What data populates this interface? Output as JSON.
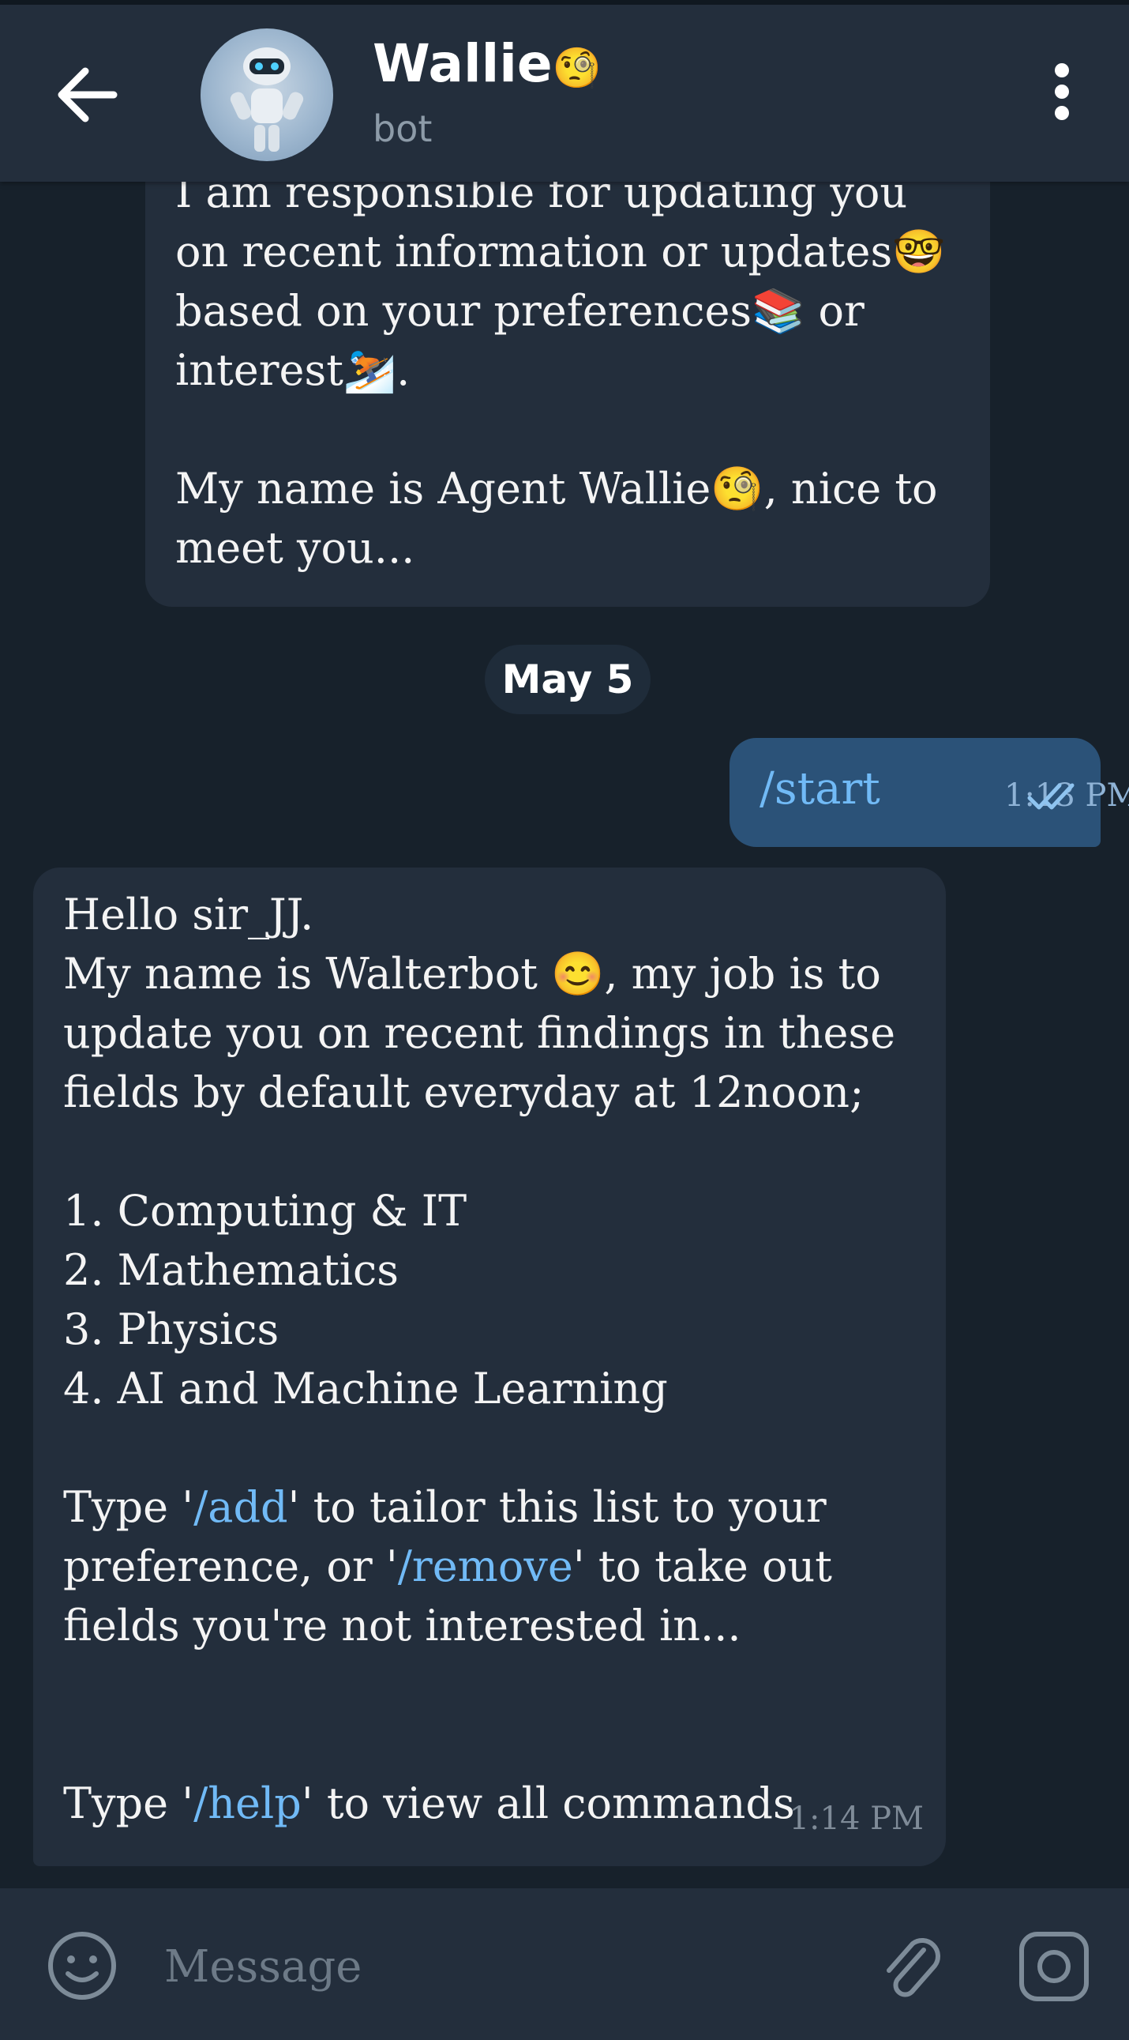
{
  "header": {
    "title": "Wallie",
    "title_emoji": "🧐",
    "subtitle": "bot"
  },
  "date_divider": "May 5",
  "messages": {
    "bot_intro_partial": {
      "lines": [
        "I am responsible for updating you",
        "on recent information or updates🤓",
        "based on your preferences📚 or",
        "interest⛷️.",
        "",
        "My name is Agent Wallie🧐, nice to",
        "meet you..."
      ]
    },
    "user_start": {
      "text": "/start",
      "time": "1:13 PM"
    },
    "bot_welcome": {
      "line1": "Hello sir_JJ.",
      "line2": "My name is Walterbot 😊, my job is to",
      "line3": "update you on recent findings in these",
      "line4": "fields by default everyday at 12noon;",
      "items": [
        "1. Computing & IT",
        "2. Mathematics",
        "3. Physics",
        "4. AI and Machine Learning"
      ],
      "type_prefix": "Type '",
      "add_cmd": "/add",
      "add_suffix": "' to tailor this list to your",
      "pref_prefix": "preference, or '",
      "remove_cmd": "/remove",
      "remove_suffix": "' to take out",
      "fields_line": "fields you're not interested in...",
      "help_prefix": "Type '",
      "help_cmd": "/help",
      "help_suffix": "' to view all commands",
      "time": "1:14 PM"
    }
  },
  "composer": {
    "placeholder": "Message"
  },
  "icons": {
    "back": "arrow-left-icon",
    "menu": "more-vertical-icon",
    "emoji": "smile-icon",
    "attach": "paperclip-icon",
    "camera": "camera-icon",
    "read": "double-check-icon"
  },
  "colors": {
    "background": "#17212b",
    "bar": "#232e3c",
    "incoming_bubble": "#232e3c",
    "outgoing_bubble": "#2b5278",
    "link": "#71baf6"
  }
}
